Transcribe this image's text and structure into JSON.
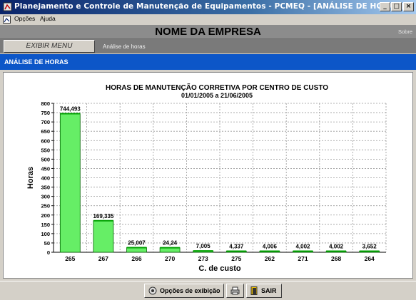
{
  "window": {
    "title": "Planejamento e Controle de Manutenção de Equipamentos - PCMEQ - [ANÁLISE DE HORAS]"
  },
  "menu": {
    "items": [
      "Opções",
      "Ajuda"
    ]
  },
  "header": {
    "company": "NOME DA EMPRESA",
    "about": "Sobre"
  },
  "toolbar": {
    "exibir_menu": "EXIBIR MENU",
    "breadcrumb": "Análise de horas"
  },
  "section": {
    "title": "ANÁLISE DE HORAS"
  },
  "chart_data": {
    "type": "bar",
    "title": "HORAS DE MANUTENÇÃO CORRETIVA POR CENTRO DE CUSTO",
    "subtitle": "01/01/2005 a 21/06/2005",
    "xlabel": "C. de custo",
    "ylabel": "Horas",
    "categories": [
      "265",
      "267",
      "266",
      "270",
      "273",
      "275",
      "262",
      "271",
      "268",
      "264"
    ],
    "values": [
      744.493,
      169.335,
      25.007,
      24.24,
      7.005,
      4.337,
      4.006,
      4.002,
      4.002,
      3.652
    ],
    "value_labels": [
      "744,493",
      "169,335",
      "25,007",
      "24,24",
      "7,005",
      "4,337",
      "4,006",
      "4,002",
      "4,002",
      "3,652"
    ],
    "ylim": [
      0,
      800
    ],
    "yticks": [
      0,
      50,
      100,
      150,
      200,
      250,
      300,
      350,
      400,
      450,
      500,
      550,
      600,
      650,
      700,
      750,
      800
    ],
    "grid": true,
    "bar_color": "#66ee66",
    "bar_top_color": "#00a000"
  },
  "footer": {
    "options_label": "Opções de exibição",
    "exit_label": "SAIR"
  },
  "icons": {
    "print": "printer-icon",
    "exit": "door-exit-icon",
    "options": "display-options-icon"
  }
}
